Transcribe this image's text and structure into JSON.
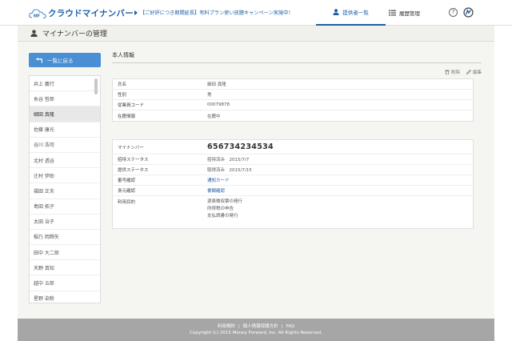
{
  "header": {
    "app_name": "クラウドマイナンバー",
    "logo_prefix": "MF",
    "campaign_text": "【ご好評につき期間延長】有料プラン使い放題キャンペーン実施中！",
    "nav_provider": "提供者一覧",
    "nav_history": "履歴管理",
    "help": "?"
  },
  "titlebar": {
    "title": "マイナンバーの管理"
  },
  "sidebar": {
    "back_label": "一覧に戻る",
    "items": [
      "井上 義行",
      "糸谷 哲郎",
      "細田 真隆",
      "佐藤 康光",
      "谷川 浩司",
      "北村 透谷",
      "辻村 伊助",
      "福田 正夫",
      "島田 拓子",
      "太田 治子",
      "稲乃 岡輝矢",
      "田中 大二郎",
      "天野 真知",
      "越中 五郎",
      "星野 染粉"
    ],
    "selected_index": 2
  },
  "content": {
    "section_title": "本人情報",
    "delete_label": "削除",
    "edit_label": "編集",
    "basic": [
      {
        "key": "氏名",
        "value": "細田 真隆"
      },
      {
        "key": "性別",
        "value": "男"
      },
      {
        "key": "従業員コード",
        "value": "00079878"
      },
      {
        "key": "在籍情報",
        "value": "在籍中"
      }
    ],
    "mynumber": {
      "label": "マイナンバー",
      "value": "656734234534"
    },
    "invite_status": {
      "key": "招待ステータス",
      "value": "招待済み　2015/7/7"
    },
    "provide_status": {
      "key": "提供ステータス",
      "value": "取得済み　2015/7/15"
    },
    "number_check": {
      "key": "番号確認",
      "value": "通知カード"
    },
    "identity_check": {
      "key": "身元確認",
      "value": "書類確認"
    },
    "purpose": {
      "key": "利用目的",
      "lines": [
        "源泉徴収票の発行",
        "所得税の申告",
        "支払調書の発行"
      ]
    }
  },
  "footer": {
    "terms": "利用規約",
    "privacy": "個人情報保護方針",
    "faq": "FAQ",
    "copyright": "Copyright (c) 2015 Money Forward, Inc. All Rights Reserved."
  },
  "colors": {
    "brand": "#1d5fa8",
    "button": "#4a8fd4",
    "footer": "#a6a6a6"
  }
}
